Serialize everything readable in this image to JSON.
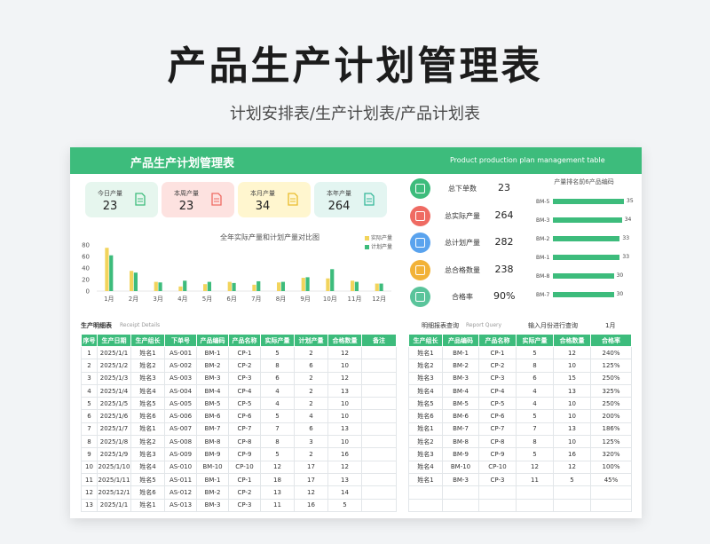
{
  "hero": {
    "title": "产品生产计划管理表",
    "subtitle": "计划安排表/生产计划表/产品计划表"
  },
  "sheet": {
    "title": "产品生产计划管理表",
    "title_en": "Product production plan management table"
  },
  "kpis": [
    {
      "label": "今日产量",
      "value": "23",
      "bg": "#e6f6ee",
      "icon": "document-icon",
      "color": "#3dbc7c"
    },
    {
      "label": "本周产量",
      "value": "23",
      "bg": "#fde2e0",
      "icon": "document-icon",
      "color": "#ef6b63"
    },
    {
      "label": "本月产量",
      "value": "34",
      "bg": "#fff6cf",
      "icon": "document-icon",
      "color": "#e9bd2c"
    },
    {
      "label": "本年产量",
      "value": "264",
      "bg": "#e3f5f1",
      "icon": "document-icon",
      "color": "#36b89a"
    }
  ],
  "stats": [
    {
      "label": "总下单数",
      "value": "23",
      "color": "#3dbc7c",
      "icon": "chart-icon"
    },
    {
      "label": "总实际产量",
      "value": "264",
      "color": "#ef6b63",
      "icon": "chart-icon"
    },
    {
      "label": "总计划产量",
      "value": "282",
      "color": "#5aa3ee",
      "icon": "chart-icon"
    },
    {
      "label": "总合格数量",
      "value": "238",
      "color": "#f2b237",
      "icon": "chart-icon"
    },
    {
      "label": "合格率",
      "value": "90%",
      "color": "#5ac49b",
      "icon": "chart-icon"
    }
  ],
  "chart_data": {
    "type": "bar",
    "title": "全年实际产量和计划产量对比图",
    "categories": [
      "1月",
      "2月",
      "3月",
      "4月",
      "5月",
      "6月",
      "7月",
      "8月",
      "9月",
      "10月",
      "11月",
      "12月"
    ],
    "series": [
      {
        "name": "实际产量",
        "color": "#f2d45c",
        "values": [
          75,
          35,
          16,
          8,
          12,
          16,
          11,
          15,
          23,
          22,
          18,
          13
        ]
      },
      {
        "name": "计划产量",
        "color": "#3dbc7c",
        "values": [
          62,
          32,
          15,
          18,
          16,
          14,
          17,
          16,
          24,
          38,
          16,
          13
        ]
      }
    ],
    "yticks": [
      0,
      20,
      40,
      60,
      80
    ],
    "ylim": [
      0,
      80
    ],
    "legend": "top-right"
  },
  "ranking": {
    "title": "产量排名前6产品编码",
    "items": [
      {
        "code": "BM-5",
        "value": 35
      },
      {
        "code": "BM-3",
        "value": 34
      },
      {
        "code": "BM-2",
        "value": 33
      },
      {
        "code": "BM-1",
        "value": 33
      },
      {
        "code": "BM-8",
        "value": 30
      },
      {
        "code": "BM-7",
        "value": 30
      }
    ]
  },
  "detail": {
    "label": "生产明细表",
    "label_en": "Receipt Details",
    "headers": [
      "序号",
      "生产日期",
      "生产组长",
      "下单号",
      "产品编码",
      "产品名称",
      "实际产量",
      "计划产量",
      "合格数量",
      "备注"
    ],
    "rows": [
      [
        "1",
        "2025/1/1",
        "姓名1",
        "AS-001",
        "BM-1",
        "CP-1",
        "5",
        "2",
        "12",
        ""
      ],
      [
        "2",
        "2025/1/2",
        "姓名2",
        "AS-002",
        "BM-2",
        "CP-2",
        "8",
        "6",
        "10",
        ""
      ],
      [
        "3",
        "2025/1/3",
        "姓名3",
        "AS-003",
        "BM-3",
        "CP-3",
        "6",
        "2",
        "12",
        ""
      ],
      [
        "4",
        "2025/1/4",
        "姓名4",
        "AS-004",
        "BM-4",
        "CP-4",
        "4",
        "2",
        "13",
        ""
      ],
      [
        "5",
        "2025/1/5",
        "姓名5",
        "AS-005",
        "BM-5",
        "CP-5",
        "4",
        "2",
        "10",
        ""
      ],
      [
        "6",
        "2025/1/6",
        "姓名6",
        "AS-006",
        "BM-6",
        "CP-6",
        "5",
        "4",
        "10",
        ""
      ],
      [
        "7",
        "2025/1/7",
        "姓名1",
        "AS-007",
        "BM-7",
        "CP-7",
        "7",
        "6",
        "13",
        ""
      ],
      [
        "8",
        "2025/1/8",
        "姓名2",
        "AS-008",
        "BM-8",
        "CP-8",
        "8",
        "3",
        "10",
        ""
      ],
      [
        "9",
        "2025/1/9",
        "姓名3",
        "AS-009",
        "BM-9",
        "CP-9",
        "5",
        "2",
        "16",
        ""
      ],
      [
        "10",
        "2025/1/10",
        "姓名4",
        "AS-010",
        "BM-10",
        "CP-10",
        "12",
        "17",
        "12",
        ""
      ],
      [
        "11",
        "2025/1/11",
        "姓名5",
        "AS-011",
        "BM-1",
        "CP-1",
        "18",
        "17",
        "13",
        ""
      ],
      [
        "12",
        "2025/12/1",
        "姓名6",
        "AS-012",
        "BM-2",
        "CP-2",
        "13",
        "12",
        "14",
        ""
      ],
      [
        "13",
        "2025/1/1",
        "姓名1",
        "AS-013",
        "BM-3",
        "CP-3",
        "11",
        "16",
        "5",
        ""
      ]
    ]
  },
  "query": {
    "label": "明细报表查询",
    "label_en": "Report Query",
    "prompt": "输入月份进行查询",
    "month": "1月",
    "headers": [
      "生产组长",
      "产品编码",
      "产品名称",
      "实际产量",
      "合格数量",
      "合格率"
    ],
    "rows": [
      [
        "姓名1",
        "BM-1",
        "CP-1",
        "5",
        "12",
        "240%"
      ],
      [
        "姓名2",
        "BM-2",
        "CP-2",
        "8",
        "10",
        "125%"
      ],
      [
        "姓名3",
        "BM-3",
        "CP-3",
        "6",
        "15",
        "250%"
      ],
      [
        "姓名4",
        "BM-4",
        "CP-4",
        "4",
        "13",
        "325%"
      ],
      [
        "姓名5",
        "BM-5",
        "CP-5",
        "4",
        "10",
        "250%"
      ],
      [
        "姓名6",
        "BM-6",
        "CP-6",
        "5",
        "10",
        "200%"
      ],
      [
        "姓名1",
        "BM-7",
        "CP-7",
        "7",
        "13",
        "186%"
      ],
      [
        "姓名2",
        "BM-8",
        "CP-8",
        "8",
        "10",
        "125%"
      ],
      [
        "姓名3",
        "BM-9",
        "CP-9",
        "5",
        "16",
        "320%"
      ],
      [
        "姓名4",
        "BM-10",
        "CP-10",
        "12",
        "12",
        "100%"
      ],
      [
        "姓名1",
        "BM-3",
        "CP-3",
        "11",
        "5",
        "45%"
      ],
      [
        "",
        "",
        "",
        "",
        "",
        ""
      ],
      [
        "",
        "",
        "",
        "",
        "",
        ""
      ]
    ]
  }
}
